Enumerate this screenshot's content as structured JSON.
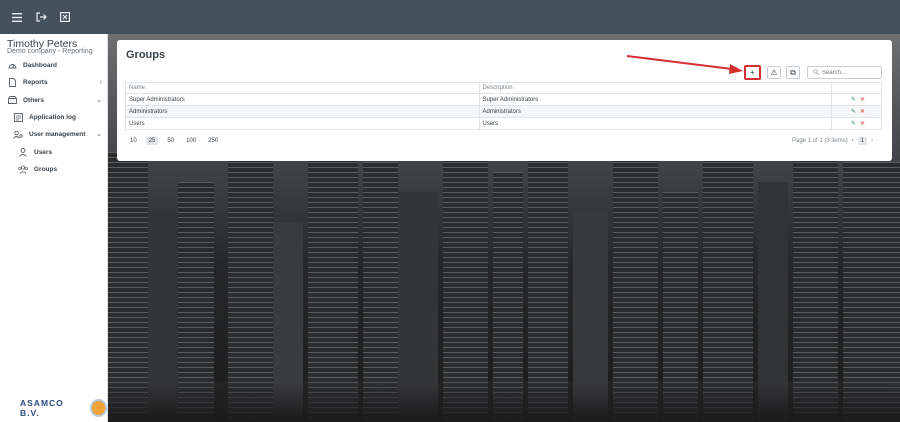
{
  "topbar": {
    "icons": [
      "menu-icon",
      "logout-icon",
      "close-square-icon"
    ]
  },
  "user": {
    "name": "Timothy Peters",
    "company": "Demo company - Reporting"
  },
  "sidebar": {
    "items": [
      {
        "label": "Dashboard",
        "icon": "dashboard-icon"
      },
      {
        "label": "Reports",
        "icon": "file-icon",
        "chevron": "›"
      },
      {
        "label": "Others",
        "icon": "box-icon",
        "chevron": "⌄"
      },
      {
        "label": "Application log",
        "icon": "log-icon"
      },
      {
        "label": "User management",
        "icon": "users-gear-icon",
        "chevron": "⌄"
      },
      {
        "label": "Users",
        "icon": "user-icon"
      },
      {
        "label": "Groups",
        "icon": "group-icon"
      }
    ]
  },
  "brand": {
    "name": "ASAMCO B.V."
  },
  "panel": {
    "title": "Groups",
    "toolbar": {
      "add_symbol": "+",
      "warn_symbol": "⚠",
      "copy_symbol": "⧉"
    },
    "search": {
      "placeholder": "Search..."
    },
    "table": {
      "headers": [
        "Name",
        "Description"
      ],
      "rows": [
        {
          "name": "Super Administrators",
          "description": "Super Administrators"
        },
        {
          "name": "Administrators",
          "description": "Administrators"
        },
        {
          "name": "Users",
          "description": "Users"
        }
      ]
    },
    "page_sizes": [
      "10",
      "25",
      "50",
      "100",
      "250"
    ],
    "selected_page_size": "25",
    "paging": {
      "text": "Page 1 of 1 (3 items)",
      "current": "1"
    }
  },
  "colors": {
    "topbar": "#44535b",
    "highlight": "#d32f2f",
    "edit": "#2e8b57",
    "delete": "#d32f2f"
  }
}
